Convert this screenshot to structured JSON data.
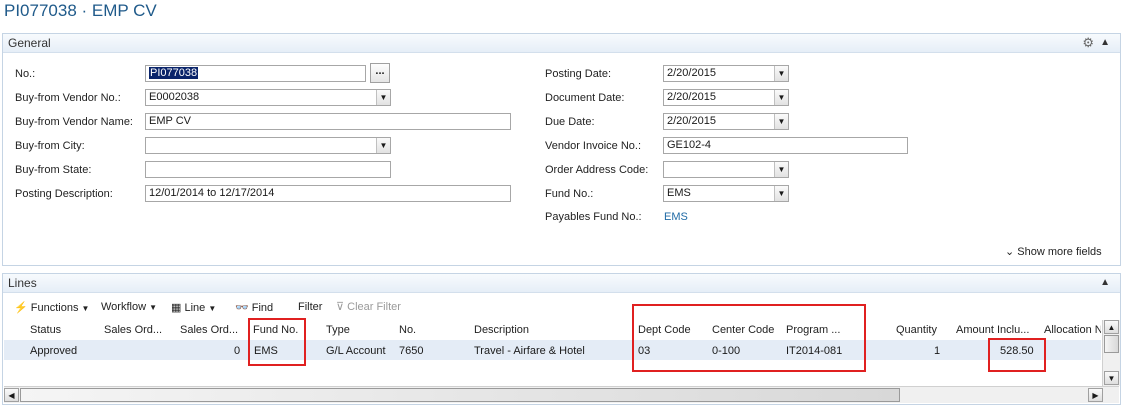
{
  "page": {
    "title": "PI077038 · EMP CV"
  },
  "general": {
    "header": "General",
    "left": [
      {
        "label": "No.:",
        "value": "PI077038"
      },
      {
        "label": "Buy-from Vendor No.:",
        "value": "E0002038"
      },
      {
        "label": "Buy-from Vendor Name:",
        "value": "EMP CV"
      },
      {
        "label": "Buy-from City:",
        "value": ""
      },
      {
        "label": "Buy-from State:",
        "value": ""
      },
      {
        "label": "Posting Description:",
        "value": "12/01/2014 to 12/17/2014"
      }
    ],
    "right": [
      {
        "label": "Posting Date:",
        "value": "2/20/2015"
      },
      {
        "label": "Document Date:",
        "value": "2/20/2015"
      },
      {
        "label": "Due Date:",
        "value": "2/20/2015"
      },
      {
        "label": "Vendor Invoice No.:",
        "value": "GE102-4"
      },
      {
        "label": "Order Address Code:",
        "value": ""
      },
      {
        "label": "Fund No.:",
        "value": "EMS"
      },
      {
        "label": "Payables Fund No.:",
        "value": "EMS"
      }
    ],
    "assist_label": "...",
    "show_more": "Show more fields"
  },
  "lines": {
    "header": "Lines",
    "toolbar": {
      "functions": "Functions",
      "workflow": "Workflow",
      "line": "Line",
      "find": "Find",
      "filter": "Filter",
      "clear_filter": "Clear Filter"
    },
    "columns": [
      "Status",
      "Sales Ord...",
      "Sales Ord...",
      "Fund No.",
      "Type",
      "No.",
      "Description",
      "Dept Code",
      "Center Code",
      "Program ...",
      "Quantity",
      "Amount Inclu...",
      "Allocation No"
    ],
    "row": [
      "Approved",
      "",
      "0",
      "EMS",
      "G/L Account",
      "7650",
      "Travel - Airfare & Hotel",
      "03",
      "0-100",
      "IT2014-081",
      "1",
      "528.50",
      ""
    ]
  },
  "colors": {
    "title": "#1f5a8a",
    "highlight": "#e02020",
    "row_selected": "#e4ecf6",
    "link": "#1f6aa5"
  }
}
